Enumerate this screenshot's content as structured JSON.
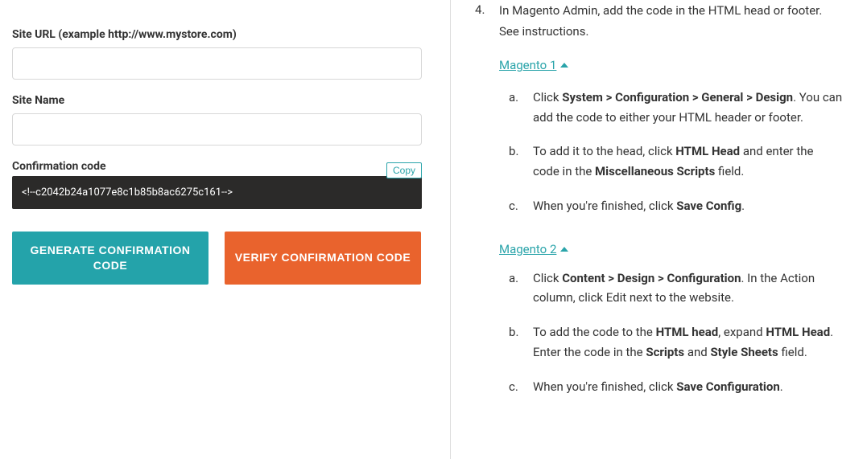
{
  "form": {
    "site_url_label": "Site URL (example http://www.mystore.com)",
    "site_url_value": "",
    "site_name_label": "Site Name",
    "site_name_value": "",
    "confirmation_code_label": "Confirmation code",
    "copy_label": "Copy",
    "confirmation_code_value": "<!--c2042b24a1077e8c1b85b8ac6275c161-->",
    "generate_btn": "GENERATE CONFIRMATION CODE",
    "verify_btn": "VERIFY CONFIRMATION CODE"
  },
  "instructions": {
    "step4_text": "In Magento Admin, add the code in the HTML head or footer. See instructions.",
    "magento1_label": "Magento 1",
    "m1": {
      "a_prefix": "Click ",
      "a_bold": "System > Configuration > General > Design",
      "a_suffix": ". You can add the code to either your HTML header or footer.",
      "b_prefix": "To add it to the head, click ",
      "b_bold1": "HTML Head",
      "b_mid": " and enter the code in the ",
      "b_bold2": "Miscellaneous Scripts",
      "b_suffix": " field.",
      "c_prefix": "When you're finished, click ",
      "c_bold": "Save Config",
      "c_suffix": "."
    },
    "magento2_label": "Magento 2",
    "m2": {
      "a_prefix": "Click ",
      "a_bold": "Content > Design > Configuration",
      "a_suffix": ". In the Action column, click Edit next to the website.",
      "b_prefix": "To add the code to the ",
      "b_bold1": "HTML head",
      "b_mid1": ", expand ",
      "b_bold2": "HTML Head",
      "b_mid2": ". Enter the code in the ",
      "b_bold3": "Scripts",
      "b_mid3": " and ",
      "b_bold4": "Style Sheets",
      "b_suffix": " field.",
      "c_prefix": "When you're finished, click ",
      "c_bold": "Save Configuration",
      "c_suffix": "."
    }
  }
}
